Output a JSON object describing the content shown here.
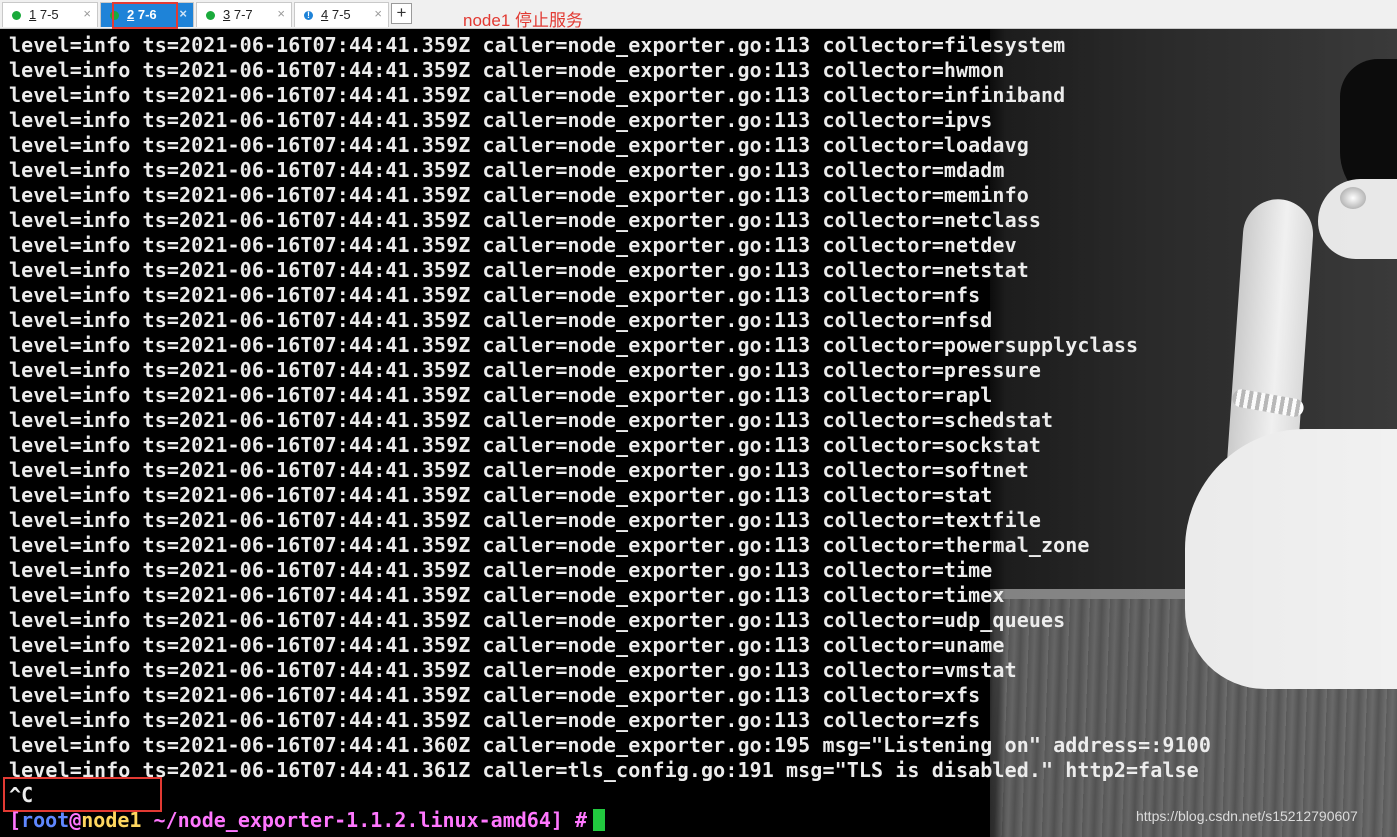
{
  "tabs": [
    {
      "num": "1",
      "title": " 7-5",
      "status": "ok",
      "close": "×"
    },
    {
      "num": "2",
      "title": " 7-6",
      "status": "ok",
      "close": "×",
      "active": true
    },
    {
      "num": "3",
      "title": " 7-7",
      "status": "ok",
      "close": "×"
    },
    {
      "num": "4",
      "title": " 7-5",
      "status": "info",
      "close": "×"
    }
  ],
  "tab_add": "+",
  "annotation": "node1  停止服务",
  "colors": {
    "annotation_red": "#e23a33",
    "active_tab": "#1e83d8",
    "status_ok": "#1aaa3c",
    "cursor": "#22c93f"
  },
  "terminal": {
    "lines": [
      "level=info ts=2021-06-16T07:44:41.359Z caller=node_exporter.go:113 collector=filesystem",
      "level=info ts=2021-06-16T07:44:41.359Z caller=node_exporter.go:113 collector=hwmon",
      "level=info ts=2021-06-16T07:44:41.359Z caller=node_exporter.go:113 collector=infiniband",
      "level=info ts=2021-06-16T07:44:41.359Z caller=node_exporter.go:113 collector=ipvs",
      "level=info ts=2021-06-16T07:44:41.359Z caller=node_exporter.go:113 collector=loadavg",
      "level=info ts=2021-06-16T07:44:41.359Z caller=node_exporter.go:113 collector=mdadm",
      "level=info ts=2021-06-16T07:44:41.359Z caller=node_exporter.go:113 collector=meminfo",
      "level=info ts=2021-06-16T07:44:41.359Z caller=node_exporter.go:113 collector=netclass",
      "level=info ts=2021-06-16T07:44:41.359Z caller=node_exporter.go:113 collector=netdev",
      "level=info ts=2021-06-16T07:44:41.359Z caller=node_exporter.go:113 collector=netstat",
      "level=info ts=2021-06-16T07:44:41.359Z caller=node_exporter.go:113 collector=nfs",
      "level=info ts=2021-06-16T07:44:41.359Z caller=node_exporter.go:113 collector=nfsd",
      "level=info ts=2021-06-16T07:44:41.359Z caller=node_exporter.go:113 collector=powersupplyclass",
      "level=info ts=2021-06-16T07:44:41.359Z caller=node_exporter.go:113 collector=pressure",
      "level=info ts=2021-06-16T07:44:41.359Z caller=node_exporter.go:113 collector=rapl",
      "level=info ts=2021-06-16T07:44:41.359Z caller=node_exporter.go:113 collector=schedstat",
      "level=info ts=2021-06-16T07:44:41.359Z caller=node_exporter.go:113 collector=sockstat",
      "level=info ts=2021-06-16T07:44:41.359Z caller=node_exporter.go:113 collector=softnet",
      "level=info ts=2021-06-16T07:44:41.359Z caller=node_exporter.go:113 collector=stat",
      "level=info ts=2021-06-16T07:44:41.359Z caller=node_exporter.go:113 collector=textfile",
      "level=info ts=2021-06-16T07:44:41.359Z caller=node_exporter.go:113 collector=thermal_zone",
      "level=info ts=2021-06-16T07:44:41.359Z caller=node_exporter.go:113 collector=time",
      "level=info ts=2021-06-16T07:44:41.359Z caller=node_exporter.go:113 collector=timex",
      "level=info ts=2021-06-16T07:44:41.359Z caller=node_exporter.go:113 collector=udp_queues",
      "level=info ts=2021-06-16T07:44:41.359Z caller=node_exporter.go:113 collector=uname",
      "level=info ts=2021-06-16T07:44:41.359Z caller=node_exporter.go:113 collector=vmstat",
      "level=info ts=2021-06-16T07:44:41.359Z caller=node_exporter.go:113 collector=xfs",
      "level=info ts=2021-06-16T07:44:41.359Z caller=node_exporter.go:113 collector=zfs",
      "level=info ts=2021-06-16T07:44:41.360Z caller=node_exporter.go:195 msg=\"Listening on\" address=:9100",
      "level=info ts=2021-06-16T07:44:41.361Z caller=tls_config.go:191 msg=\"TLS is disabled.\" http2=false",
      "^C"
    ],
    "prompt": {
      "open": "[",
      "user": "root",
      "at": "@",
      "host": "node1",
      "path": " ~/node_exporter-1.1.2.linux-amd64]",
      "symbol": " #"
    }
  },
  "watermark": "https://blog.csdn.net/s15212790607"
}
